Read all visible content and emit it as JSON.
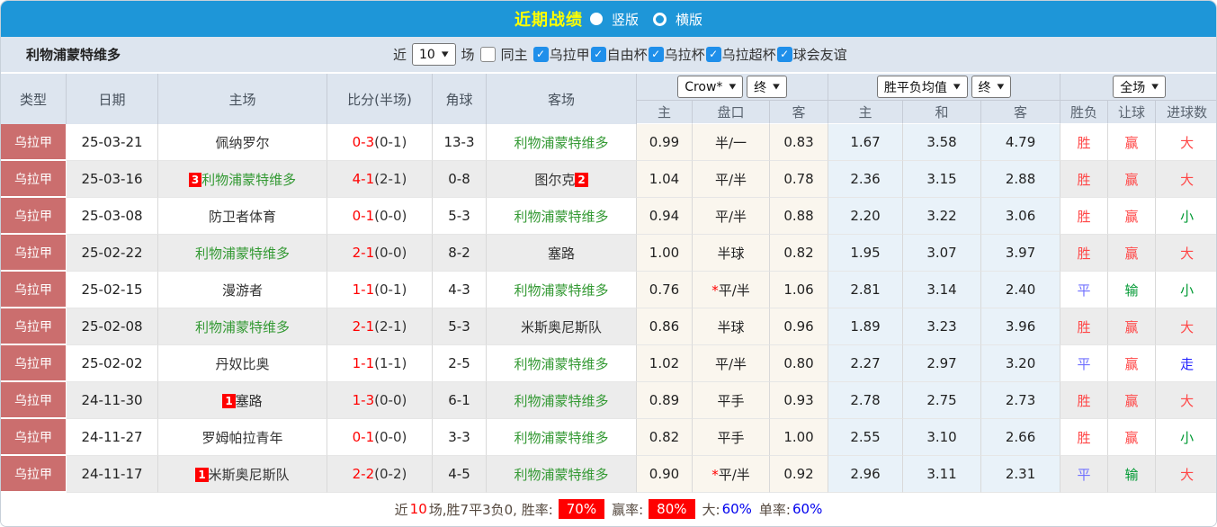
{
  "topbar": {
    "title": "近期战绩",
    "radio_vertical": "竖版",
    "radio_horizontal": "横版"
  },
  "filterbar": {
    "team_name": "利物浦蒙特维多",
    "near_label": "近",
    "near_value": "10",
    "games_label": "场",
    "same_home_label": "同主",
    "leagues": [
      "乌拉甲",
      "自由杯",
      "乌拉杯",
      "乌拉超杯",
      "球会友谊"
    ],
    "checkbox_checked_glyph": "✓"
  },
  "table": {
    "columns": [
      "类型",
      "日期",
      "主场",
      "比分(半场)",
      "角球",
      "客场",
      "主",
      "盘口",
      "客",
      "主",
      "和",
      "客",
      "胜负",
      "让球",
      "进球数"
    ],
    "group_headers": {
      "asia_source": "Crow*",
      "asia_time": "终",
      "eu_source": "胜平负均值",
      "eu_time": "终",
      "scope": "全场"
    },
    "rows": [
      {
        "league": "乌拉甲",
        "date": "25-03-21",
        "home": {
          "name": "佩纳罗尔",
          "color": "dark",
          "badge": "",
          "badge_after": false
        },
        "score": "0-3",
        "half": "(0-1)",
        "corners": "13-3",
        "away": {
          "name": "利物浦蒙特维多",
          "color": "green",
          "badge": "",
          "badge_after": false
        },
        "asia_home": "0.99",
        "handicap": "半/一",
        "handicap_star": false,
        "asia_away": "0.83",
        "eu_home": "1.67",
        "eu_draw": "3.58",
        "eu_away": "4.79",
        "result": "胜",
        "handicap_result": "赢",
        "goals_result": "大"
      },
      {
        "league": "乌拉甲",
        "date": "25-03-16",
        "home": {
          "name": "利物浦蒙特维多",
          "color": "green",
          "badge": "3",
          "badge_after": false
        },
        "score": "4-1",
        "half": "(2-1)",
        "corners": "0-8",
        "away": {
          "name": "图尔克",
          "color": "dark",
          "badge": "2",
          "badge_after": true
        },
        "asia_home": "1.04",
        "handicap": "平/半",
        "handicap_star": false,
        "asia_away": "0.78",
        "eu_home": "2.36",
        "eu_draw": "3.15",
        "eu_away": "2.88",
        "result": "胜",
        "handicap_result": "赢",
        "goals_result": "大"
      },
      {
        "league": "乌拉甲",
        "date": "25-03-08",
        "home": {
          "name": "防卫者体育",
          "color": "dark",
          "badge": "",
          "badge_after": false
        },
        "score": "0-1",
        "half": "(0-0)",
        "corners": "5-3",
        "away": {
          "name": "利物浦蒙特维多",
          "color": "green",
          "badge": "",
          "badge_after": false
        },
        "asia_home": "0.94",
        "handicap": "平/半",
        "handicap_star": false,
        "asia_away": "0.88",
        "eu_home": "2.20",
        "eu_draw": "3.22",
        "eu_away": "3.06",
        "result": "胜",
        "handicap_result": "赢",
        "goals_result": "小"
      },
      {
        "league": "乌拉甲",
        "date": "25-02-22",
        "home": {
          "name": "利物浦蒙特维多",
          "color": "green",
          "badge": "",
          "badge_after": false
        },
        "score": "2-1",
        "half": "(0-0)",
        "corners": "8-2",
        "away": {
          "name": "塞路",
          "color": "dark",
          "badge": "",
          "badge_after": false
        },
        "asia_home": "1.00",
        "handicap": "半球",
        "handicap_star": false,
        "asia_away": "0.82",
        "eu_home": "1.95",
        "eu_draw": "3.07",
        "eu_away": "3.97",
        "result": "胜",
        "handicap_result": "赢",
        "goals_result": "大"
      },
      {
        "league": "乌拉甲",
        "date": "25-02-15",
        "home": {
          "name": "漫游者",
          "color": "dark",
          "badge": "",
          "badge_after": false
        },
        "score": "1-1",
        "half": "(0-1)",
        "corners": "4-3",
        "away": {
          "name": "利物浦蒙特维多",
          "color": "green",
          "badge": "",
          "badge_after": false
        },
        "asia_home": "0.76",
        "handicap": "平/半",
        "handicap_star": true,
        "asia_away": "1.06",
        "eu_home": "2.81",
        "eu_draw": "3.14",
        "eu_away": "2.40",
        "result": "平",
        "handicap_result": "输",
        "goals_result": "小"
      },
      {
        "league": "乌拉甲",
        "date": "25-02-08",
        "home": {
          "name": "利物浦蒙特维多",
          "color": "green",
          "badge": "",
          "badge_after": false
        },
        "score": "2-1",
        "half": "(2-1)",
        "corners": "5-3",
        "away": {
          "name": "米斯奥尼斯队",
          "color": "dark",
          "badge": "",
          "badge_after": false
        },
        "asia_home": "0.86",
        "handicap": "半球",
        "handicap_star": false,
        "asia_away": "0.96",
        "eu_home": "1.89",
        "eu_draw": "3.23",
        "eu_away": "3.96",
        "result": "胜",
        "handicap_result": "赢",
        "goals_result": "大"
      },
      {
        "league": "乌拉甲",
        "date": "25-02-02",
        "home": {
          "name": "丹奴比奥",
          "color": "dark",
          "badge": "",
          "badge_after": false
        },
        "score": "1-1",
        "half": "(1-1)",
        "corners": "2-5",
        "away": {
          "name": "利物浦蒙特维多",
          "color": "green",
          "badge": "",
          "badge_after": false
        },
        "asia_home": "1.02",
        "handicap": "平/半",
        "handicap_star": false,
        "asia_away": "0.80",
        "eu_home": "2.27",
        "eu_draw": "2.97",
        "eu_away": "3.20",
        "result": "平",
        "handicap_result": "赢",
        "goals_result": "走"
      },
      {
        "league": "乌拉甲",
        "date": "24-11-30",
        "home": {
          "name": "塞路",
          "color": "dark",
          "badge": "1",
          "badge_after": false
        },
        "score": "1-3",
        "half": "(0-0)",
        "corners": "6-1",
        "away": {
          "name": "利物浦蒙特维多",
          "color": "green",
          "badge": "",
          "badge_after": false
        },
        "asia_home": "0.89",
        "handicap": "平手",
        "handicap_star": false,
        "asia_away": "0.93",
        "eu_home": "2.78",
        "eu_draw": "2.75",
        "eu_away": "2.73",
        "result": "胜",
        "handicap_result": "赢",
        "goals_result": "大"
      },
      {
        "league": "乌拉甲",
        "date": "24-11-27",
        "home": {
          "name": "罗姆帕拉青年",
          "color": "dark",
          "badge": "",
          "badge_after": false
        },
        "score": "0-1",
        "half": "(0-0)",
        "corners": "3-3",
        "away": {
          "name": "利物浦蒙特维多",
          "color": "green",
          "badge": "",
          "badge_after": false
        },
        "asia_home": "0.82",
        "handicap": "平手",
        "handicap_star": false,
        "asia_away": "1.00",
        "eu_home": "2.55",
        "eu_draw": "3.10",
        "eu_away": "2.66",
        "result": "胜",
        "handicap_result": "赢",
        "goals_result": "小"
      },
      {
        "league": "乌拉甲",
        "date": "24-11-17",
        "home": {
          "name": "米斯奥尼斯队",
          "color": "dark",
          "badge": "1",
          "badge_after": false
        },
        "score": "2-2",
        "half": "(0-2)",
        "corners": "4-5",
        "away": {
          "name": "利物浦蒙特维多",
          "color": "green",
          "badge": "",
          "badge_after": false
        },
        "asia_home": "0.90",
        "handicap": "平/半",
        "handicap_star": true,
        "asia_away": "0.92",
        "eu_home": "2.96",
        "eu_draw": "3.11",
        "eu_away": "2.31",
        "result": "平",
        "handicap_result": "输",
        "goals_result": "大"
      }
    ]
  },
  "summary": {
    "near_label": "近",
    "count": "10",
    "detail": "场,胜7平3负0, 胜率:",
    "win_rate": "70%",
    "ying_label": "赢率:",
    "ying_rate": "80%",
    "big_label": "大:",
    "big_rate": "60%",
    "single_label": "单率:",
    "single_rate": "60%"
  },
  "colors": {
    "accent_blue": "#1e96d8",
    "league_red": "#cb6e6e",
    "team_green": "#339933",
    "score_red": "#ff0000",
    "win": "#ff4747",
    "draw": "#7070ff",
    "loss": "#009933",
    "go": "#2424ff",
    "rate_badge_red": "#ff0000",
    "rate_blue": "#0000ee"
  }
}
